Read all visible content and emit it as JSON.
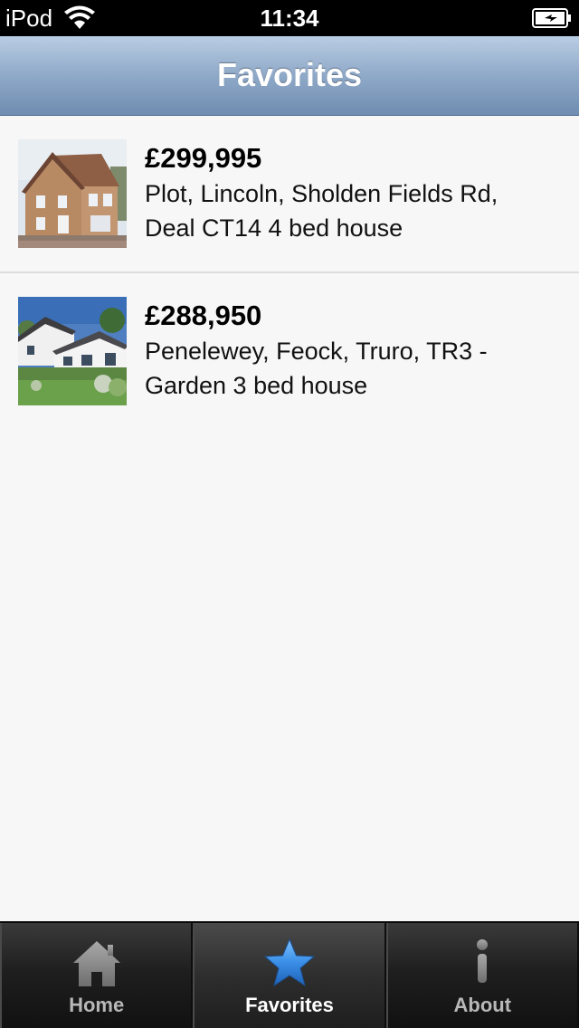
{
  "status_bar": {
    "carrier": "iPod",
    "time": "11:34"
  },
  "nav": {
    "title": "Favorites"
  },
  "favorites": [
    {
      "price": "£299,995",
      "description": "Plot, Lincoln, Sholden Fields Rd, Deal CT14 4 bed house"
    },
    {
      "price": "£288,950",
      "description": "Penelewey, Feock, Truro, TR3 - Garden 3 bed house"
    }
  ],
  "tabs": [
    {
      "label": "Home",
      "icon": "home-icon",
      "active": false
    },
    {
      "label": "Favorites",
      "icon": "star-icon",
      "active": true
    },
    {
      "label": "About",
      "icon": "info-icon",
      "active": false
    }
  ],
  "colors": {
    "nav_gradient_top": "#b9cde3",
    "nav_gradient_bottom": "#6f8db1",
    "tab_active_icon": "#3a8ee6",
    "list_background": "#f7f7f7"
  }
}
